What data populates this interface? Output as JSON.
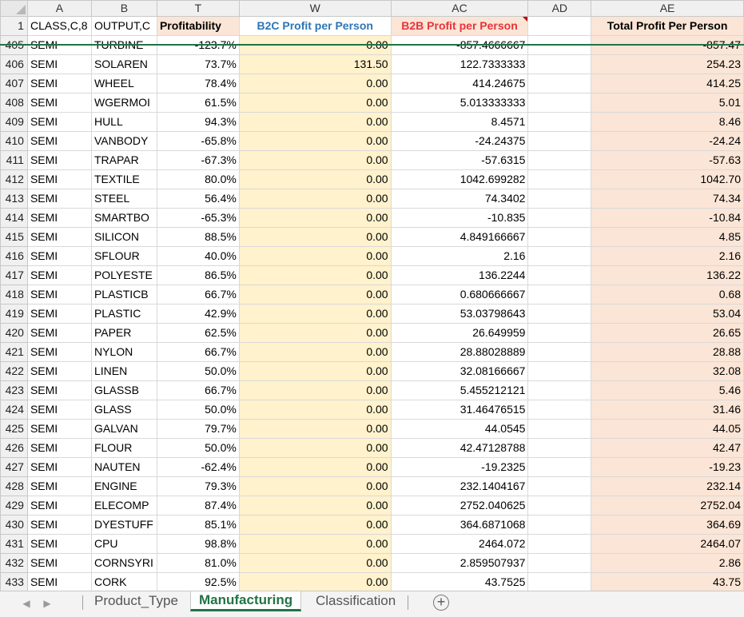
{
  "columns": [
    "A",
    "B",
    "T",
    "W",
    "AC",
    "AD",
    "AE"
  ],
  "header_row": {
    "row_num": "1",
    "a": "CLASS,C,8",
    "b": "OUTPUT,C",
    "t": "Profitability",
    "w": "B2C Profit per Person",
    "ac": "B2B Profit per Person",
    "ad": "",
    "ae": "Total Profit Per Person"
  },
  "rows": [
    {
      "n": "405",
      "a": "SEMI",
      "b": "TURBINE",
      "t": "-123.7%",
      "w": "0.00",
      "ac": "-857.4666667",
      "ae": "-857.47"
    },
    {
      "n": "406",
      "a": "SEMI",
      "b": "SOLAREN",
      "t": "73.7%",
      "w": "131.50",
      "ac": "122.7333333",
      "ae": "254.23"
    },
    {
      "n": "407",
      "a": "SEMI",
      "b": "WHEEL",
      "t": "78.4%",
      "w": "0.00",
      "ac": "414.24675",
      "ae": "414.25"
    },
    {
      "n": "408",
      "a": "SEMI",
      "b": "WGERMOI",
      "t": "61.5%",
      "w": "0.00",
      "ac": "5.013333333",
      "ae": "5.01"
    },
    {
      "n": "409",
      "a": "SEMI",
      "b": "HULL",
      "t": "94.3%",
      "w": "0.00",
      "ac": "8.4571",
      "ae": "8.46"
    },
    {
      "n": "410",
      "a": "SEMI",
      "b": "VANBODY",
      "t": "-65.8%",
      "w": "0.00",
      "ac": "-24.24375",
      "ae": "-24.24"
    },
    {
      "n": "411",
      "a": "SEMI",
      "b": "TRAPAR",
      "t": "-67.3%",
      "w": "0.00",
      "ac": "-57.6315",
      "ae": "-57.63"
    },
    {
      "n": "412",
      "a": "SEMI",
      "b": "TEXTILE",
      "t": "80.0%",
      "w": "0.00",
      "ac": "1042.699282",
      "ae": "1042.70"
    },
    {
      "n": "413",
      "a": "SEMI",
      "b": "STEEL",
      "t": "56.4%",
      "w": "0.00",
      "ac": "74.3402",
      "ae": "74.34"
    },
    {
      "n": "414",
      "a": "SEMI",
      "b": "SMARTBO",
      "t": "-65.3%",
      "w": "0.00",
      "ac": "-10.835",
      "ae": "-10.84"
    },
    {
      "n": "415",
      "a": "SEMI",
      "b": "SILICON",
      "t": "88.5%",
      "w": "0.00",
      "ac": "4.849166667",
      "ae": "4.85"
    },
    {
      "n": "416",
      "a": "SEMI",
      "b": "SFLOUR",
      "t": "40.0%",
      "w": "0.00",
      "ac": "2.16",
      "ae": "2.16"
    },
    {
      "n": "417",
      "a": "SEMI",
      "b": "POLYESTE",
      "t": "86.5%",
      "w": "0.00",
      "ac": "136.2244",
      "ae": "136.22"
    },
    {
      "n": "418",
      "a": "SEMI",
      "b": "PLASTICB",
      "t": "66.7%",
      "w": "0.00",
      "ac": "0.680666667",
      "ae": "0.68"
    },
    {
      "n": "419",
      "a": "SEMI",
      "b": "PLASTIC",
      "t": "42.9%",
      "w": "0.00",
      "ac": "53.03798643",
      "ae": "53.04"
    },
    {
      "n": "420",
      "a": "SEMI",
      "b": "PAPER",
      "t": "62.5%",
      "w": "0.00",
      "ac": "26.649959",
      "ae": "26.65"
    },
    {
      "n": "421",
      "a": "SEMI",
      "b": "NYLON",
      "t": "66.7%",
      "w": "0.00",
      "ac": "28.88028889",
      "ae": "28.88"
    },
    {
      "n": "422",
      "a": "SEMI",
      "b": "LINEN",
      "t": "50.0%",
      "w": "0.00",
      "ac": "32.08166667",
      "ae": "32.08"
    },
    {
      "n": "423",
      "a": "SEMI",
      "b": "GLASSB",
      "t": "66.7%",
      "w": "0.00",
      "ac": "5.455212121",
      "ae": "5.46"
    },
    {
      "n": "424",
      "a": "SEMI",
      "b": "GLASS",
      "t": "50.0%",
      "w": "0.00",
      "ac": "31.46476515",
      "ae": "31.46"
    },
    {
      "n": "425",
      "a": "SEMI",
      "b": "GALVAN",
      "t": "79.7%",
      "w": "0.00",
      "ac": "44.0545",
      "ae": "44.05"
    },
    {
      "n": "426",
      "a": "SEMI",
      "b": "FLOUR",
      "t": "50.0%",
      "w": "0.00",
      "ac": "42.47128788",
      "ae": "42.47"
    },
    {
      "n": "427",
      "a": "SEMI",
      "b": "NAUTEN",
      "t": "-62.4%",
      "w": "0.00",
      "ac": "-19.2325",
      "ae": "-19.23"
    },
    {
      "n": "428",
      "a": "SEMI",
      "b": "ENGINE",
      "t": "79.3%",
      "w": "0.00",
      "ac": "232.1404167",
      "ae": "232.14"
    },
    {
      "n": "429",
      "a": "SEMI",
      "b": "ELECOMP",
      "t": "87.4%",
      "w": "0.00",
      "ac": "2752.040625",
      "ae": "2752.04"
    },
    {
      "n": "430",
      "a": "SEMI",
      "b": "DYESTUFF",
      "t": "85.1%",
      "w": "0.00",
      "ac": "364.6871068",
      "ae": "364.69"
    },
    {
      "n": "431",
      "a": "SEMI",
      "b": "CPU",
      "t": "98.8%",
      "w": "0.00",
      "ac": "2464.072",
      "ae": "2464.07"
    },
    {
      "n": "432",
      "a": "SEMI",
      "b": "CORNSYRI",
      "t": "81.0%",
      "w": "0.00",
      "ac": "2.859507937",
      "ae": "2.86"
    },
    {
      "n": "433",
      "a": "SEMI",
      "b": "CORK",
      "t": "92.5%",
      "w": "0.00",
      "ac": "43.7525",
      "ae": "43.75"
    }
  ],
  "tabs": [
    "Product_Type",
    "Manufacturing",
    "Classification"
  ],
  "active_tab": "Manufacturing",
  "add_sheet_icon": "plus-circle-icon",
  "colors": {
    "b2c_header": "#2e75b6",
    "b2b_header": "#e8333b",
    "peach_fill": "#fbe5d6",
    "yellow_fill": "#fff2cc",
    "active_tab": "#217346"
  }
}
